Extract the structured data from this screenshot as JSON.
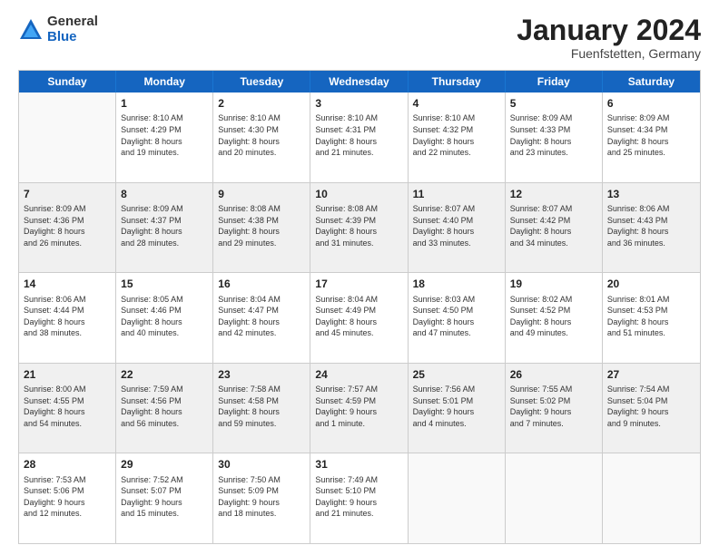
{
  "logo": {
    "general": "General",
    "blue": "Blue"
  },
  "header": {
    "title": "January 2024",
    "subtitle": "Fuenfstetten, Germany"
  },
  "calendar": {
    "days": [
      "Sunday",
      "Monday",
      "Tuesday",
      "Wednesday",
      "Thursday",
      "Friday",
      "Saturday"
    ],
    "rows": [
      [
        {
          "day": "",
          "text": ""
        },
        {
          "day": "1",
          "text": "Sunrise: 8:10 AM\nSunset: 4:29 PM\nDaylight: 8 hours\nand 19 minutes."
        },
        {
          "day": "2",
          "text": "Sunrise: 8:10 AM\nSunset: 4:30 PM\nDaylight: 8 hours\nand 20 minutes."
        },
        {
          "day": "3",
          "text": "Sunrise: 8:10 AM\nSunset: 4:31 PM\nDaylight: 8 hours\nand 21 minutes."
        },
        {
          "day": "4",
          "text": "Sunrise: 8:10 AM\nSunset: 4:32 PM\nDaylight: 8 hours\nand 22 minutes."
        },
        {
          "day": "5",
          "text": "Sunrise: 8:09 AM\nSunset: 4:33 PM\nDaylight: 8 hours\nand 23 minutes."
        },
        {
          "day": "6",
          "text": "Sunrise: 8:09 AM\nSunset: 4:34 PM\nDaylight: 8 hours\nand 25 minutes."
        }
      ],
      [
        {
          "day": "7",
          "text": "Sunrise: 8:09 AM\nSunset: 4:36 PM\nDaylight: 8 hours\nand 26 minutes."
        },
        {
          "day": "8",
          "text": "Sunrise: 8:09 AM\nSunset: 4:37 PM\nDaylight: 8 hours\nand 28 minutes."
        },
        {
          "day": "9",
          "text": "Sunrise: 8:08 AM\nSunset: 4:38 PM\nDaylight: 8 hours\nand 29 minutes."
        },
        {
          "day": "10",
          "text": "Sunrise: 8:08 AM\nSunset: 4:39 PM\nDaylight: 8 hours\nand 31 minutes."
        },
        {
          "day": "11",
          "text": "Sunrise: 8:07 AM\nSunset: 4:40 PM\nDaylight: 8 hours\nand 33 minutes."
        },
        {
          "day": "12",
          "text": "Sunrise: 8:07 AM\nSunset: 4:42 PM\nDaylight: 8 hours\nand 34 minutes."
        },
        {
          "day": "13",
          "text": "Sunrise: 8:06 AM\nSunset: 4:43 PM\nDaylight: 8 hours\nand 36 minutes."
        }
      ],
      [
        {
          "day": "14",
          "text": "Sunrise: 8:06 AM\nSunset: 4:44 PM\nDaylight: 8 hours\nand 38 minutes."
        },
        {
          "day": "15",
          "text": "Sunrise: 8:05 AM\nSunset: 4:46 PM\nDaylight: 8 hours\nand 40 minutes."
        },
        {
          "day": "16",
          "text": "Sunrise: 8:04 AM\nSunset: 4:47 PM\nDaylight: 8 hours\nand 42 minutes."
        },
        {
          "day": "17",
          "text": "Sunrise: 8:04 AM\nSunset: 4:49 PM\nDaylight: 8 hours\nand 45 minutes."
        },
        {
          "day": "18",
          "text": "Sunrise: 8:03 AM\nSunset: 4:50 PM\nDaylight: 8 hours\nand 47 minutes."
        },
        {
          "day": "19",
          "text": "Sunrise: 8:02 AM\nSunset: 4:52 PM\nDaylight: 8 hours\nand 49 minutes."
        },
        {
          "day": "20",
          "text": "Sunrise: 8:01 AM\nSunset: 4:53 PM\nDaylight: 8 hours\nand 51 minutes."
        }
      ],
      [
        {
          "day": "21",
          "text": "Sunrise: 8:00 AM\nSunset: 4:55 PM\nDaylight: 8 hours\nand 54 minutes."
        },
        {
          "day": "22",
          "text": "Sunrise: 7:59 AM\nSunset: 4:56 PM\nDaylight: 8 hours\nand 56 minutes."
        },
        {
          "day": "23",
          "text": "Sunrise: 7:58 AM\nSunset: 4:58 PM\nDaylight: 8 hours\nand 59 minutes."
        },
        {
          "day": "24",
          "text": "Sunrise: 7:57 AM\nSunset: 4:59 PM\nDaylight: 9 hours\nand 1 minute."
        },
        {
          "day": "25",
          "text": "Sunrise: 7:56 AM\nSunset: 5:01 PM\nDaylight: 9 hours\nand 4 minutes."
        },
        {
          "day": "26",
          "text": "Sunrise: 7:55 AM\nSunset: 5:02 PM\nDaylight: 9 hours\nand 7 minutes."
        },
        {
          "day": "27",
          "text": "Sunrise: 7:54 AM\nSunset: 5:04 PM\nDaylight: 9 hours\nand 9 minutes."
        }
      ],
      [
        {
          "day": "28",
          "text": "Sunrise: 7:53 AM\nSunset: 5:06 PM\nDaylight: 9 hours\nand 12 minutes."
        },
        {
          "day": "29",
          "text": "Sunrise: 7:52 AM\nSunset: 5:07 PM\nDaylight: 9 hours\nand 15 minutes."
        },
        {
          "day": "30",
          "text": "Sunrise: 7:50 AM\nSunset: 5:09 PM\nDaylight: 9 hours\nand 18 minutes."
        },
        {
          "day": "31",
          "text": "Sunrise: 7:49 AM\nSunset: 5:10 PM\nDaylight: 9 hours\nand 21 minutes."
        },
        {
          "day": "",
          "text": ""
        },
        {
          "day": "",
          "text": ""
        },
        {
          "day": "",
          "text": ""
        }
      ]
    ]
  }
}
